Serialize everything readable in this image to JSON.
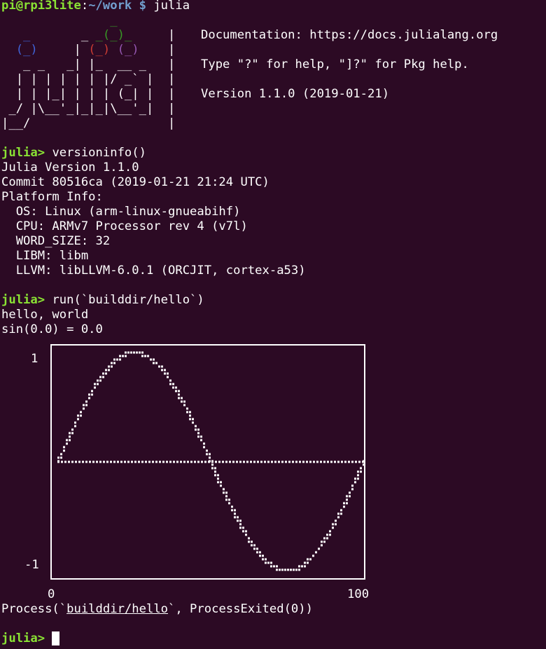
{
  "shell": {
    "user_host": "pi@rpi3lite",
    "colon": ":",
    "cwd": "~/work",
    "prompt_symbol": " $",
    "command": " julia"
  },
  "banner": {
    "logo_lines": [
      "               _",
      "   _       _ _(_)_     |",
      "  (_)     | (_) (_)    |",
      "   _ _   _| |_  __ _   |",
      "  | | | | | | |/ _` |  |",
      "  | | |_| | | | (_| |  |",
      " _/ |\\__'_|_|_|\\__'_|  |",
      "|__/                   |"
    ],
    "doc_label": "Documentation: https://docs.julialang.org",
    "help_text": "Type \"?\" for help, \"]?\" for Pkg help.",
    "version_text": "Version 1.1.0 (2019-01-21)"
  },
  "repl": {
    "prompt": "julia>",
    "cmd1": " versioninfo()",
    "output1": [
      "Julia Version 1.1.0",
      "Commit 80516ca (2019-01-21 21:24 UTC)",
      "Platform Info:",
      "  OS: Linux (arm-linux-gnueabihf)",
      "  CPU: ARMv7 Processor rev 4 (v7l)",
      "  WORD_SIZE: 32",
      "  LIBM: libm",
      "  LLVM: libLLVM-6.0.1 (ORCJIT, cortex-a53)"
    ],
    "cmd2": " run(`builddir/hello`)",
    "output2": [
      "hello, world",
      "sin(0.0) = 0.0"
    ],
    "process_prefix": "Process(`",
    "process_cmd": "builddir/hello",
    "process_suffix": "`, ProcessExited(0))"
  },
  "chart_data": {
    "type": "line",
    "series": [
      {
        "function": "sin",
        "x_range": [
          0,
          100
        ]
      }
    ],
    "baseline": 0,
    "xlim": [
      0,
      100
    ],
    "ylim": [
      -1,
      1
    ],
    "x_tick_labels": [
      "0",
      "100"
    ],
    "y_tick_labels": [
      "1",
      "-1"
    ],
    "colors": {
      "foreground": "#ffffff",
      "background": "#2c0a24"
    }
  },
  "colors": {
    "background": "#2c0a24",
    "prompt_green": "#8ae234",
    "path_blue": "#729fcf",
    "julia_blue": "#4063d8",
    "julia_red": "#cb3c33",
    "julia_green": "#389826",
    "julia_purple": "#9558b2"
  }
}
